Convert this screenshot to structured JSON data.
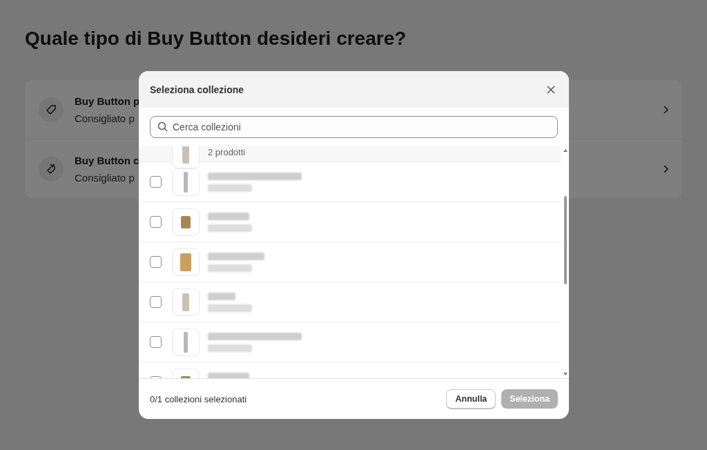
{
  "page": {
    "title": "Quale tipo di Buy Button desideri creare?",
    "options": [
      {
        "kind": "tag",
        "title": "Buy Button p",
        "description": "Consigliato p"
      },
      {
        "kind": "tags",
        "title": "Buy Button c",
        "description": "Consigliato p"
      }
    ]
  },
  "dialog": {
    "title": "Seleziona collezione",
    "search": {
      "placeholder": "Cerca collezioni"
    },
    "rows": [
      {
        "subtitle": "2 prodotti"
      },
      {
        "checked": false
      },
      {
        "checked": false
      },
      {
        "checked": false
      },
      {
        "checked": false
      },
      {
        "checked": false
      },
      {
        "checked": false
      }
    ],
    "footer": {
      "count": "0/1 collezioni selezionati",
      "buttons": [
        {
          "label": "Annulla",
          "kind": "secondary",
          "disabled": false
        },
        {
          "label": "Seleziona",
          "kind": "primary",
          "disabled": true
        }
      ]
    }
  }
}
